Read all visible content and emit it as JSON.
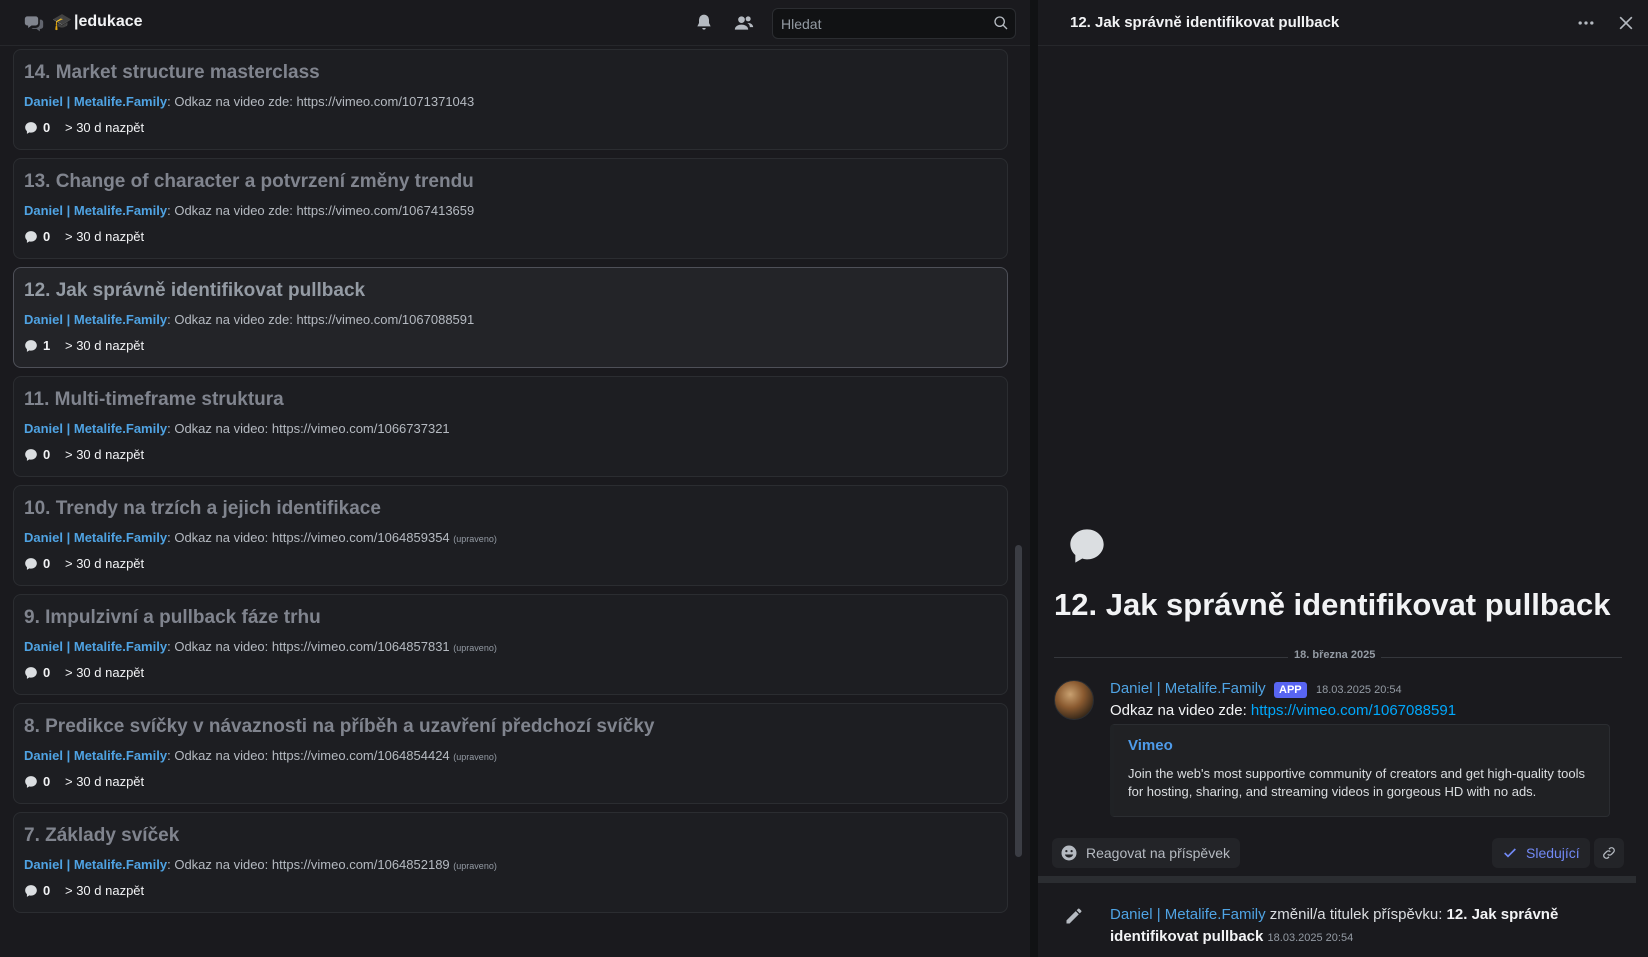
{
  "header": {
    "emoji": "🎓",
    "channel_name": "|edukace",
    "search_placeholder": "Hledat"
  },
  "posts": [
    {
      "title": "14. Market structure masterclass",
      "author": "Daniel | Metalife.Family",
      "sep": ":",
      "text": "Odkaz na video zde: https://vimeo.com/1071371043",
      "edited": "",
      "count": "0",
      "age": "> 30 d nazpět"
    },
    {
      "title": "13. Change of character a potvrzení změny trendu",
      "author": "Daniel | Metalife.Family",
      "sep": ":",
      "text": "Odkaz na video zde: https://vimeo.com/1067413659",
      "edited": "",
      "count": "0",
      "age": "> 30 d nazpět"
    },
    {
      "title": "12. Jak správně identifikovat pullback",
      "author": "Daniel | Metalife.Family",
      "sep": ":",
      "text": "Odkaz na video zde: https://vimeo.com/1067088591",
      "edited": "",
      "count": "1",
      "age": "> 30 d nazpět"
    },
    {
      "title": "11. Multi-timeframe struktura",
      "author": "Daniel | Metalife.Family",
      "sep": ":",
      "text": "Odkaz na video: https://vimeo.com/1066737321",
      "edited": "",
      "count": "0",
      "age": "> 30 d nazpět"
    },
    {
      "title": "10. Trendy na trzích a jejich identifikace",
      "author": "Daniel | Metalife.Family",
      "sep": ":",
      "text": "Odkaz na video: https://vimeo.com/1064859354",
      "edited": "(upraveno)",
      "count": "0",
      "age": "> 30 d nazpět"
    },
    {
      "title": "9. Impulzivní a pullback fáze trhu",
      "author": "Daniel | Metalife.Family",
      "sep": ":",
      "text": "Odkaz na video: https://vimeo.com/1064857831",
      "edited": "(upraveno)",
      "count": "0",
      "age": "> 30 d nazpět"
    },
    {
      "title": "8. Predikce svíčky v návaznosti na příběh a uzavření předchozí svíčky",
      "author": "Daniel | Metalife.Family",
      "sep": ":",
      "text": "Odkaz na video: https://vimeo.com/1064854424",
      "edited": "(upraveno)",
      "count": "0",
      "age": "> 30 d nazpět"
    },
    {
      "title": "7. Základy svíček",
      "author": "Daniel | Metalife.Family",
      "sep": ":",
      "text": "Odkaz na video: https://vimeo.com/1064852189",
      "edited": "(upraveno)",
      "count": "0",
      "age": "> 30 d nazpět"
    }
  ],
  "thread": {
    "header_title": "12. Jak správně identifikovat pullback",
    "title": "12. Jak správně identifikovat pullback",
    "date_divider": "18. března 2025",
    "message": {
      "author": "Daniel | Metalife.Family",
      "badge": "APP",
      "timestamp": "18.03.2025 20:54",
      "text_prefix": "Odkaz na video zde: ",
      "link": "https://vimeo.com/1067088591"
    },
    "embed": {
      "provider": "Vimeo",
      "description": "Join the web's most supportive community of creators and get high-quality tools for hosting, sharing, and streaming videos in gorgeous HD with no ads."
    },
    "actions": {
      "react_label": "Reagovat na příspěvek",
      "follow_label": "Sledující"
    },
    "system_message": {
      "author": "Daniel | Metalife.Family",
      "text": " změnil/a titulek příspěvku: ",
      "new_title": "12. Jak správně identifikovat pullback",
      "timestamp": "18.03.2025 20:54"
    }
  }
}
